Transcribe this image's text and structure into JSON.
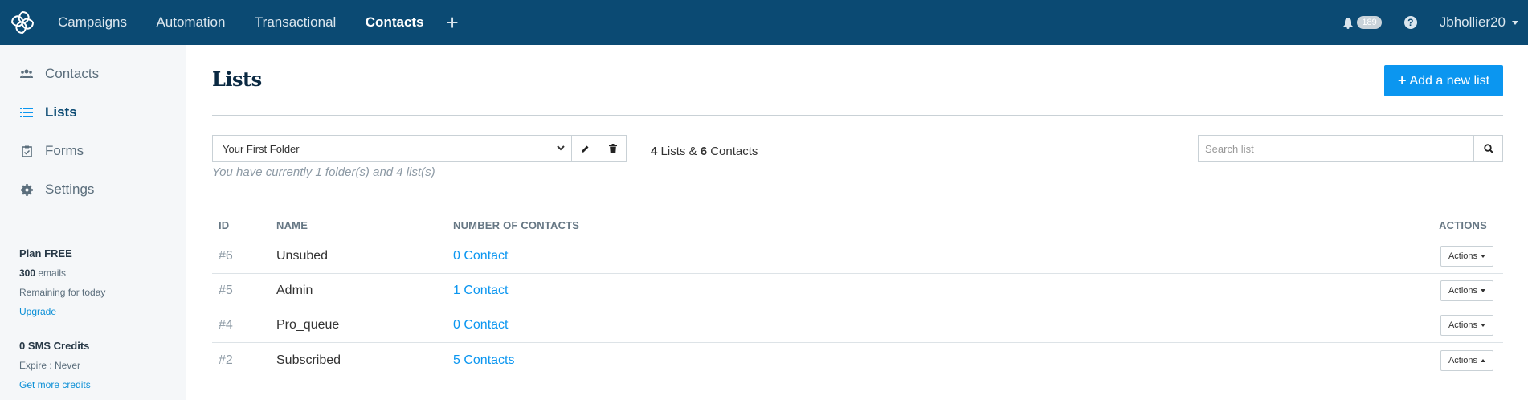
{
  "topbar": {
    "nav": [
      "Campaigns",
      "Automation",
      "Transactional",
      "Contacts"
    ],
    "active": "Contacts",
    "notification_count": "189",
    "username": "Jbhollier20"
  },
  "sidebar": {
    "items": [
      {
        "label": "Contacts",
        "icon": "users-icon"
      },
      {
        "label": "Lists",
        "icon": "list-icon"
      },
      {
        "label": "Forms",
        "icon": "clipboard-icon"
      },
      {
        "label": "Settings",
        "icon": "gear-icon"
      }
    ],
    "plan_title": "Plan FREE",
    "emails_count": "300",
    "emails_label": "emails",
    "remaining": "Remaining for today",
    "upgrade": "Upgrade",
    "sms_title": "0 SMS Credits",
    "sms_expire": "Expire : Never",
    "sms_link": "Get more credits"
  },
  "main": {
    "title": "Lists",
    "add_button": "Add a new list",
    "folder_select": "Your First Folder",
    "folder_note": "You have currently 1 folder(s) and 4 list(s)",
    "lists_count": "4",
    "lists_label": "Lists &",
    "contacts_count": "6",
    "contacts_label": "Contacts",
    "search_placeholder": "Search list"
  },
  "table": {
    "headers": {
      "id": "ID",
      "name": "NAME",
      "num": "NUMBER OF CONTACTS",
      "actions": "ACTIONS"
    },
    "rows": [
      {
        "id": "#6",
        "name": "Unsubed",
        "contacts": "0 Contact",
        "action": "Actions"
      },
      {
        "id": "#5",
        "name": "Admin",
        "contacts": "1 Contact",
        "action": "Actions"
      },
      {
        "id": "#4",
        "name": "Pro_queue",
        "contacts": "0 Contact",
        "action": "Actions"
      },
      {
        "id": "#2",
        "name": "Subscribed",
        "contacts": "5 Contacts",
        "action": "Actions"
      }
    ]
  },
  "colors": {
    "topbar": "#0b4a73",
    "accent": "#0b96f0"
  }
}
